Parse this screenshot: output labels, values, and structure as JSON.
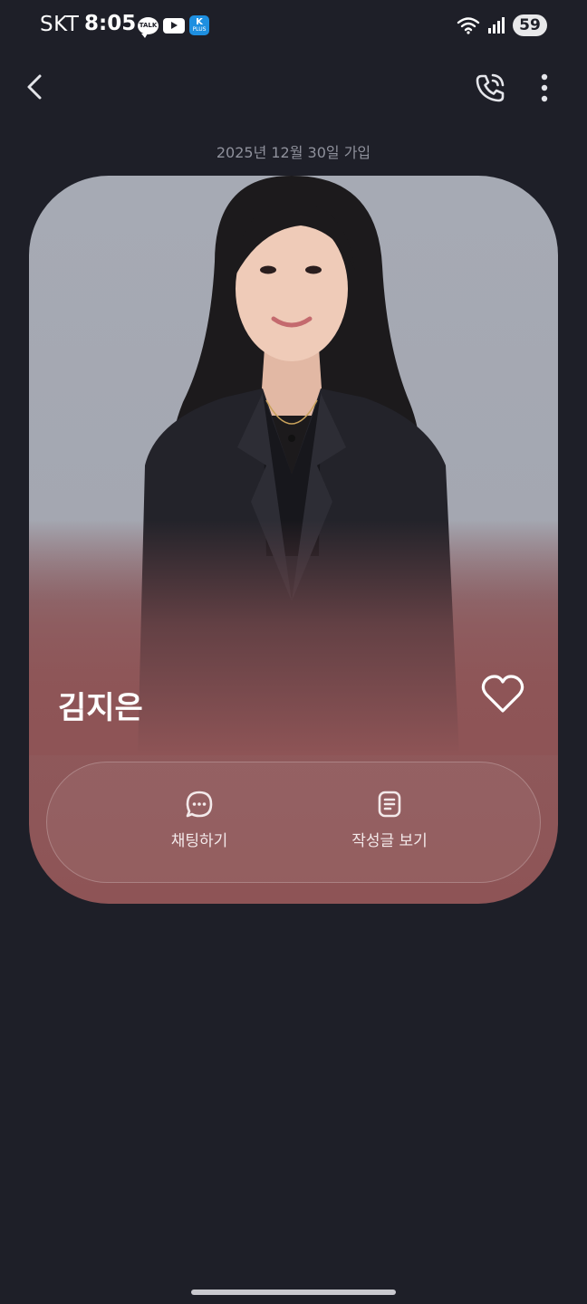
{
  "status_bar": {
    "carrier": "SKT",
    "time": "8:05",
    "talk_label": "TALK",
    "plus_label": "PLUS",
    "battery": "59",
    "notification_icons": [
      "kakaotalk-icon",
      "youtube-icon",
      "plus-app-icon"
    ],
    "system_icons": [
      "wifi-icon",
      "signal-icon",
      "battery-icon"
    ]
  },
  "top_nav": {
    "back_icon": "chevron-left-icon",
    "call_icon": "phone-call-icon",
    "more_icon": "more-vertical-icon"
  },
  "profile": {
    "join_date": "2025년 12월 30일 가입",
    "name": "김지은",
    "favorite_icon": "heart-icon"
  },
  "actions": {
    "chat_label": "채팅하기",
    "chat_icon": "chat-bubble-icon",
    "posts_label": "작성글 보기",
    "posts_icon": "document-icon"
  },
  "colors": {
    "background": "#1e1f28",
    "card_bottom": "#8e5456",
    "photo_background": "#a6aab4",
    "muted_text": "#8f919c"
  }
}
